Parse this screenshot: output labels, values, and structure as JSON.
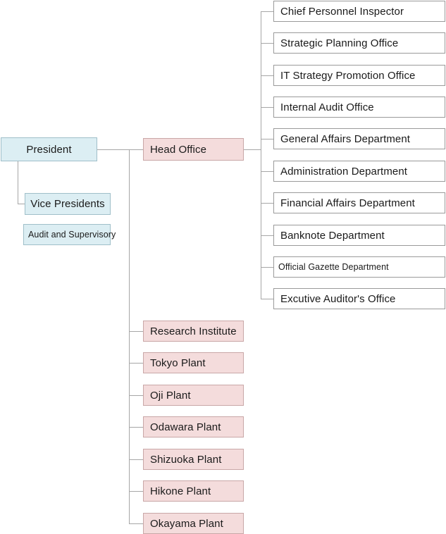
{
  "diagram": {
    "title": "Organization Chart",
    "colors": {
      "executive_fill": "#dceef3",
      "executive_border": "#9fbfc9",
      "division_fill": "#f4dcdc",
      "division_border": "#c9a7a7",
      "office_fill": "#ffffff",
      "office_border": "#9a9a9a",
      "connector": "#a6a6a6",
      "text": "#1a1a1a"
    },
    "executive": {
      "root": {
        "label": "President"
      },
      "subordinates": [
        {
          "label": "Vice Presidents"
        },
        {
          "label": "Audit and Supervisory"
        }
      ]
    },
    "divisions": [
      {
        "label": "Head Office"
      },
      {
        "label": "Research Institute"
      },
      {
        "label": "Tokyo Plant"
      },
      {
        "label": "Oji Plant"
      },
      {
        "label": "Odawara Plant"
      },
      {
        "label": "Shizuoka Plant"
      },
      {
        "label": "Hikone Plant"
      },
      {
        "label": "Okayama Plant"
      }
    ],
    "head_office_units": [
      {
        "label": "Chief Personnel Inspector"
      },
      {
        "label": "Strategic Planning Office"
      },
      {
        "label": "IT Strategy Promotion Office"
      },
      {
        "label": "Internal Audit Office"
      },
      {
        "label": "General Affairs Department"
      },
      {
        "label": "Administration Department"
      },
      {
        "label": "Financial Affairs Department"
      },
      {
        "label": "Banknote Department"
      },
      {
        "label": "Official Gazette Department"
      },
      {
        "label": "Excutive Auditor's Office"
      }
    ]
  }
}
